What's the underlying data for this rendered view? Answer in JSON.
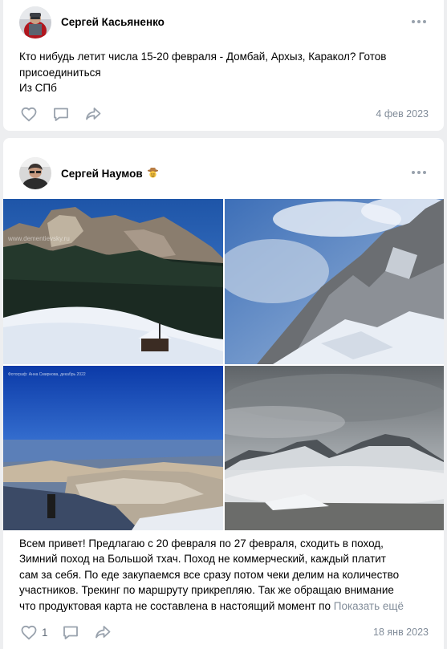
{
  "posts": [
    {
      "author": "Сергей Касьяненко",
      "text_lines": [
        "Кто нибудь летит числа 15-20 февраля - Домбай, Архыз, Каракол? Готов",
        "присоединиться",
        "Из СПб"
      ],
      "date": "4 фев 2023",
      "icons": {
        "like": "heart-icon",
        "comment": "comment-icon",
        "share": "share-icon",
        "more": "more-dots-icon"
      }
    },
    {
      "author": "Сергей Наумов",
      "author_badge": "cowboy-emoji",
      "photos": [
        {
          "name": "winter-forest-cliffs-photo",
          "watermark": "www.dementievsky.ru"
        },
        {
          "name": "snowy-cliff-clouds-photo",
          "watermark": ""
        },
        {
          "name": "mountain-plateau-blue-sky-photo",
          "watermark": "Фотограф: Анна Смирнова, декабрь 2022"
        },
        {
          "name": "misty-mountains-photo",
          "watermark": ""
        }
      ],
      "text_lines": [
        "Всем привет! Предлагаю с 20 февраля по 27 февраля, сходить в поход,",
        "Зимний поход на Большой тхач. Поход не коммерческий, каждый платит",
        "сам за себя. По еде закупаемся все сразу потом чеки делим на количество",
        "участников. Трекинг по маршруту прикрепляю. Так же обращаю внимание",
        "что продуктовая карта не составлена в настоящий момент по"
      ],
      "text_fade": "",
      "show_more": "Показать ещё",
      "likes": "1",
      "date": "18 янв 2023",
      "colors": {
        "secondary_text": "#818c99",
        "icon": "#99a2ad",
        "background": "#edeef0"
      }
    }
  ]
}
